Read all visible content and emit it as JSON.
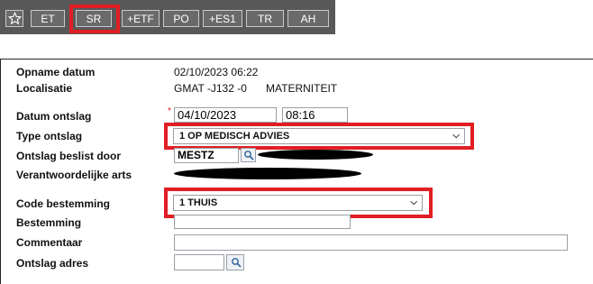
{
  "toolbar": {
    "buttons": [
      {
        "label": "ET"
      },
      {
        "label": "SR"
      },
      {
        "label": "+ETF"
      },
      {
        "label": "PO"
      },
      {
        "label": "+ES1"
      },
      {
        "label": "TR"
      },
      {
        "label": "AH"
      }
    ]
  },
  "form": {
    "opname_datum": {
      "label": "Opname datum",
      "value": "02/10/2023 06:22"
    },
    "localisatie": {
      "label": "Localisatie",
      "value": "GMAT -J132 -0",
      "value2": "MATERNITEIT"
    },
    "datum_ontslag": {
      "label": "Datum ontslag",
      "date": "04/10/2023",
      "time": "08:16",
      "required_marker": "*"
    },
    "type_ontslag": {
      "label": "Type ontslag",
      "selected": "1 OP MEDISCH ADVIES"
    },
    "ontslag_beslist_door": {
      "label": "Ontslag beslist door",
      "value": "MESTZ"
    },
    "verantwoordelijke_arts": {
      "label": "Verantwoordelijke arts"
    },
    "code_bestemming": {
      "label": "Code bestemming",
      "selected": "1 THUIS"
    },
    "bestemming": {
      "label": "Bestemming",
      "value": ""
    },
    "commentaar": {
      "label": "Commentaar",
      "value": ""
    },
    "ontslag_adres": {
      "label": "Ontslag adres",
      "value": ""
    }
  },
  "colors": {
    "highlight": "#e01e24",
    "toolbar_bg": "#585858"
  },
  "icons": [
    "star-icon",
    "magnifier-icon",
    "chevron-down-icon"
  ]
}
